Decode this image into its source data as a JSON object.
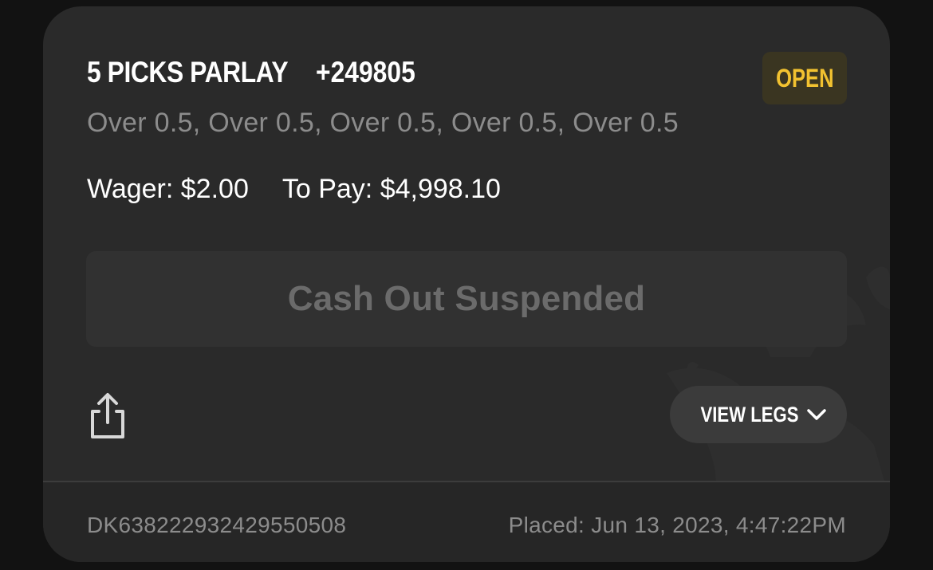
{
  "bet": {
    "title": "5 PICKS PARLAY",
    "odds": "+249805",
    "status": "OPEN",
    "selections": "Over 0.5, Over 0.5, Over 0.5, Over 0.5, Over 0.5",
    "wager_text": "Wager: $2.00",
    "to_pay_text": "To Pay: $4,998.10"
  },
  "actions": {
    "cash_out_label": "Cash Out Suspended",
    "view_legs_label": "VIEW LEGS",
    "share_icon": "share-icon",
    "chevron_icon": "chevron-down-icon"
  },
  "footer": {
    "bet_id": "DK638222932429550508",
    "placed": "Placed: Jun 13, 2023, 4:47:22PM"
  },
  "colors": {
    "background": "#121212",
    "card": "#2a2a2a",
    "status_text": "#f2c230",
    "status_bg": "#3a3521",
    "muted_text": "#8c8c8c",
    "disabled_button": "#313131"
  }
}
